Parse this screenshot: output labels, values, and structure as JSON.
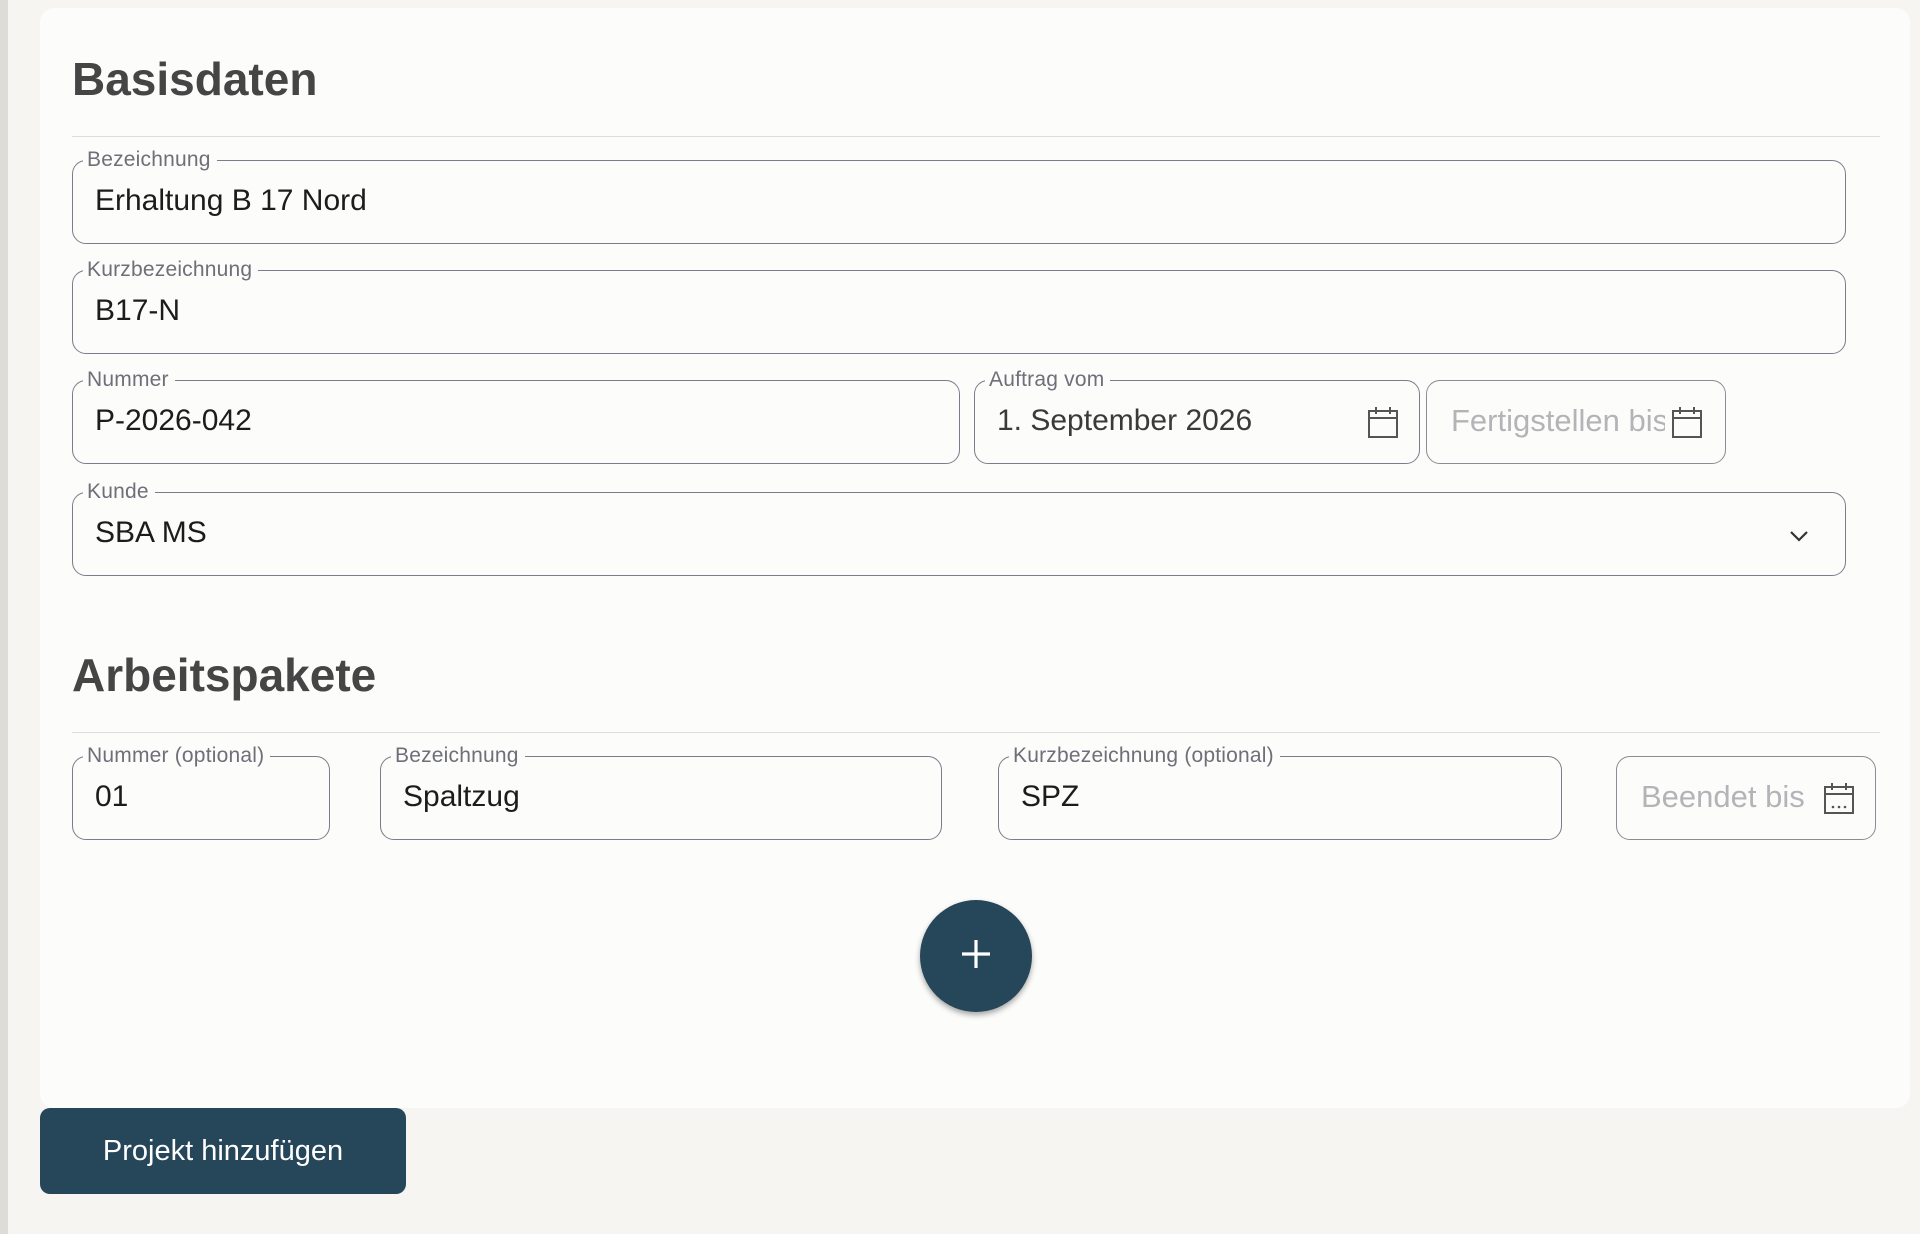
{
  "basisdaten": {
    "title": "Basisdaten",
    "bezeichnung": {
      "label": "Bezeichnung",
      "value": "Erhaltung B 17 Nord"
    },
    "kurzbezeichnung": {
      "label": "Kurzbezeichnung",
      "value": "B17-N"
    },
    "nummer": {
      "label": "Nummer",
      "value": "P-2026-042"
    },
    "auftrag_vom": {
      "label": "Auftrag vom",
      "value": "1. September 2026",
      "icon": "calendar-icon"
    },
    "fertigstellen_bis": {
      "placeholder": "Fertigstellen bis",
      "icon": "calendar-icon"
    },
    "kunde": {
      "label": "Kunde",
      "value": "SBA MS",
      "icon": "chevron-down-icon"
    }
  },
  "arbeitspakete": {
    "title": "Arbeitspakete",
    "rows": [
      {
        "nummer": {
          "label": "Nummer (optional)",
          "value": "01"
        },
        "bezeichnung": {
          "label": "Bezeichnung",
          "value": "Spaltzug"
        },
        "kurzbezeichnung": {
          "label": "Kurzbezeichnung (optional)",
          "value": "SPZ"
        },
        "beendet_bis": {
          "placeholder": "Beendet bis",
          "icon": "calendar-icon"
        }
      }
    ],
    "add_icon": "plus-icon"
  },
  "actions": {
    "submit_label": "Projekt hinzufügen"
  },
  "colors": {
    "primary": "#26465a",
    "page_background": "#f6f5f2",
    "card_background": "#fcfcfb",
    "outline": "#7c7d8c",
    "heading": "#454545"
  }
}
